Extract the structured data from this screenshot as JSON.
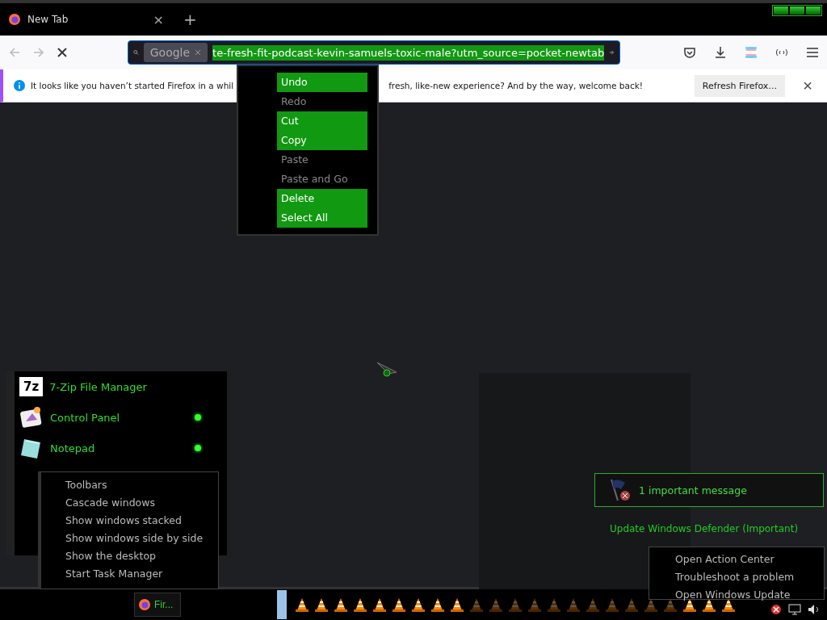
{
  "tab_bar": {
    "tab": {
      "title": "New Tab",
      "close": "×"
    },
    "new_tab": "+"
  },
  "nav_bar": {
    "search_engine": "Google",
    "url": "te-fresh-fit-podcast-kevin-samuels-toxic-male?utm_source=pocket-newtab"
  },
  "notification": {
    "text_before": "It looks like you haven’t started Firefox in a whil",
    "text_after": "fresh, like-new experience? And by the way, welcome back!",
    "button": "Refresh Firefox…",
    "close": "×"
  },
  "edit_menu": [
    {
      "label": "Undo",
      "enabled": true
    },
    {
      "label": "Redo",
      "enabled": false
    },
    {
      "label": "Cut",
      "enabled": true
    },
    {
      "label": "Copy",
      "enabled": true
    },
    {
      "label": "Paste",
      "enabled": false
    },
    {
      "label": "Paste and Go",
      "enabled": false
    },
    {
      "label": "Delete",
      "enabled": true
    },
    {
      "label": "Select All",
      "enabled": true
    }
  ],
  "start_menu": [
    {
      "label": "7-Zip File Manager",
      "kind": "zip",
      "running": false,
      "logo": "7z"
    },
    {
      "label": "Control Panel",
      "kind": "panel",
      "running": true
    },
    {
      "label": "Notepad",
      "kind": "notepad",
      "running": true
    }
  ],
  "taskbar_menu": [
    "Toolbars",
    "Cascade windows",
    "Show windows stacked",
    "Show windows side by side",
    "Show the desktop",
    "Start Task Manager"
  ],
  "action_popup": {
    "title": "1 important message",
    "item": "Update Windows Defender (Important)"
  },
  "tray_menu": [
    "Open Action Center",
    "Troubleshoot a problem",
    "Open Windows Update"
  ],
  "taskbar": {
    "app_button": "Fir...",
    "launch_icons": [
      {
        "dimmed": false
      },
      {
        "dimmed": false
      },
      {
        "dimmed": false
      },
      {
        "dimmed": false
      },
      {
        "dimmed": false
      },
      {
        "dimmed": false
      },
      {
        "dimmed": false
      },
      {
        "dimmed": false
      },
      {
        "dimmed": false
      },
      {
        "dimmed": true
      },
      {
        "dimmed": true
      },
      {
        "dimmed": true
      },
      {
        "dimmed": true
      },
      {
        "dimmed": true
      },
      {
        "dimmed": true
      },
      {
        "dimmed": true
      },
      {
        "dimmed": true
      },
      {
        "dimmed": true
      },
      {
        "dimmed": true
      },
      {
        "dimmed": true
      },
      {
        "dimmed": false
      },
      {
        "dimmed": false
      },
      {
        "dimmed": false
      }
    ]
  }
}
